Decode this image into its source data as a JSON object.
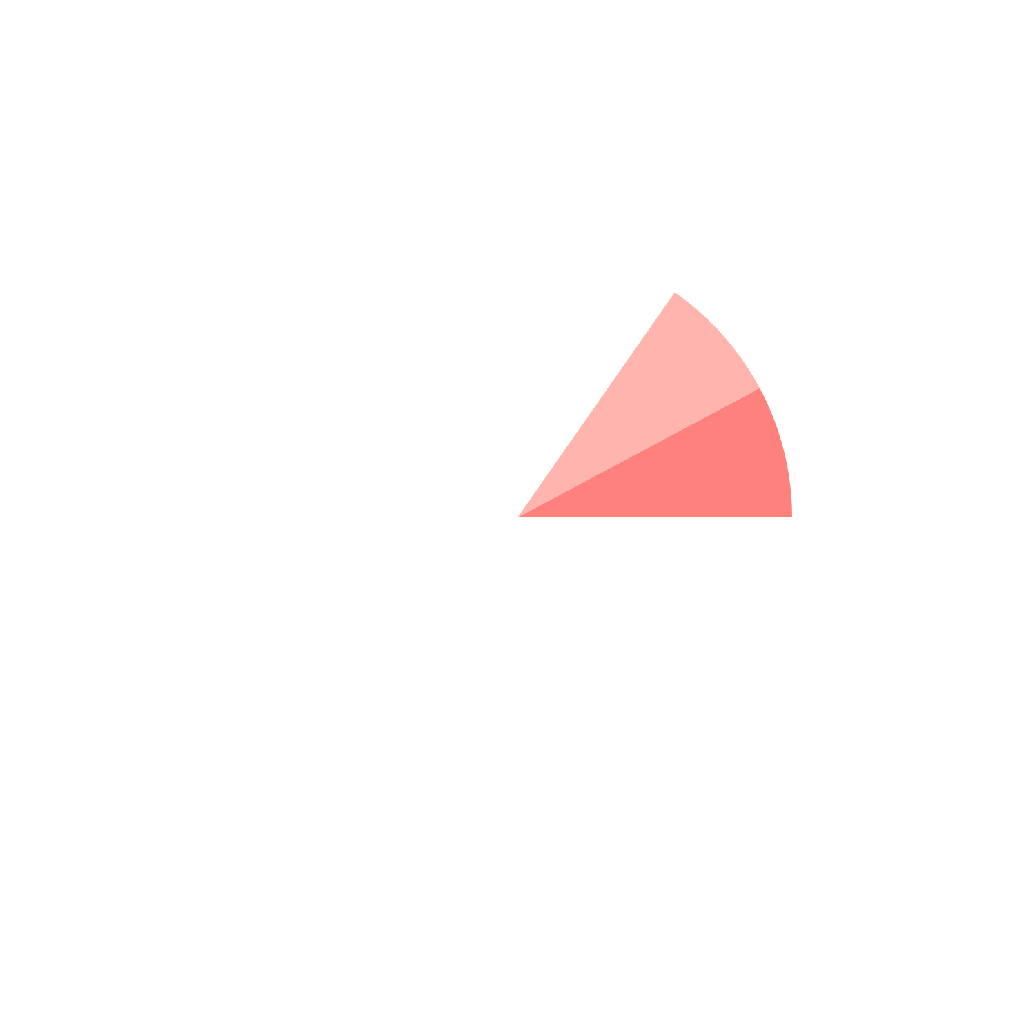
{
  "chart_data": {
    "type": "pie",
    "start_angle_deg": 0,
    "direction": "counterclockwise",
    "total": 100,
    "slices": [
      {
        "label": "",
        "value": 7.8,
        "color": "#FF817D"
      },
      {
        "label": "",
        "value": 7.5,
        "color": "#FFB5AD"
      },
      {
        "label": "",
        "value": 84.7,
        "color": "#FFFFFF"
      }
    ]
  }
}
